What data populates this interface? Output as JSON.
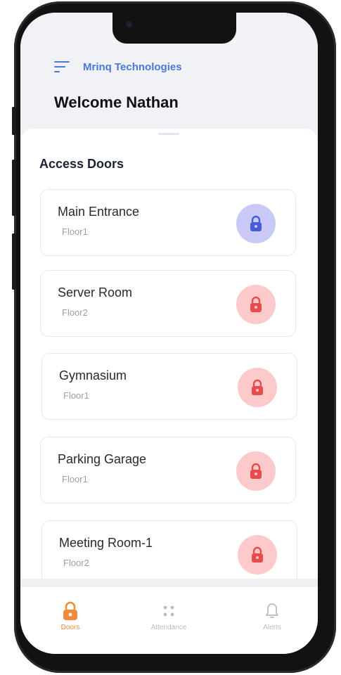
{
  "header": {
    "company": "Mrinq Technologies",
    "welcome": "Welcome Nathan"
  },
  "section_title": "Access Doors",
  "doors": [
    {
      "name": "Main Entrance",
      "floor": "Floor1",
      "state": "unlocked"
    },
    {
      "name": "Server Room",
      "floor": "Floor2",
      "state": "locked"
    },
    {
      "name": "Gymnasium",
      "floor": "Floor1",
      "state": "locked"
    },
    {
      "name": "Parking Garage",
      "floor": "Floor1",
      "state": "locked"
    },
    {
      "name": "Meeting Room-1",
      "floor": "Floor2",
      "state": "locked"
    }
  ],
  "tabs": [
    {
      "label": "Doors",
      "icon": "lock-icon",
      "active": true
    },
    {
      "label": "Attendance",
      "icon": "dots-grid-icon",
      "active": false
    },
    {
      "label": "Alerts",
      "icon": "bell-icon",
      "active": false
    }
  ],
  "colors": {
    "accent_blue": "#4a78e0",
    "unlocked_icon": "#4a5bd8",
    "unlocked_bg": "#c9c9f7",
    "locked_icon": "#e84b4b",
    "locked_bg": "#fccaca",
    "active_tab": "#f28a3c",
    "inactive_tab": "#b8bcc4"
  }
}
